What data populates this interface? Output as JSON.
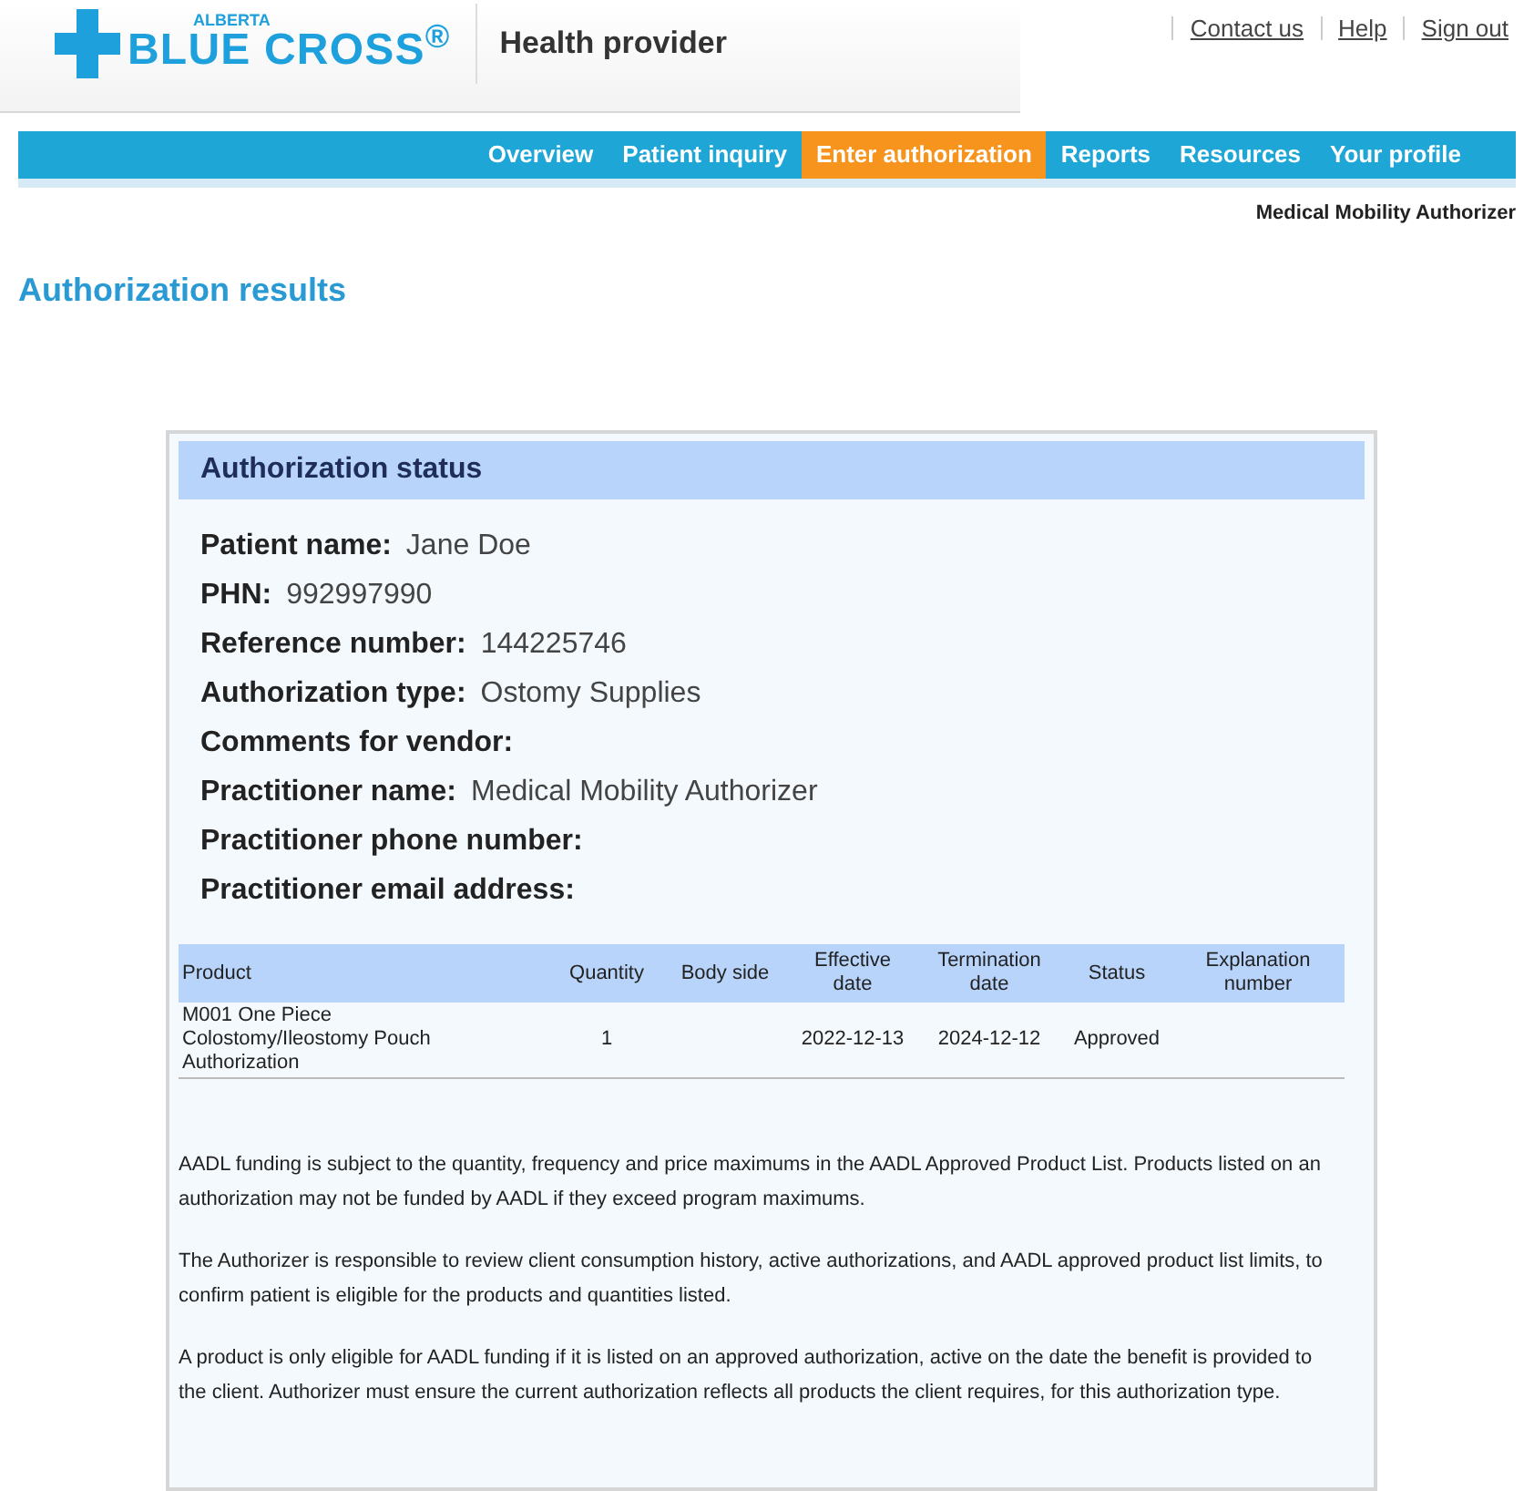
{
  "header": {
    "logo_top": "ALBERTA",
    "logo_main": "BLUE CROSS$^{®}$",
    "portal": "Health provider",
    "links": [
      "Contact us",
      "Help",
      "Sign out"
    ]
  },
  "nav": [
    {
      "label": "Overview",
      "selected": false
    },
    {
      "label": "Patient inquiry",
      "selected": false
    },
    {
      "label": "Enter authorization",
      "selected": true
    },
    {
      "label": "Reports",
      "selected": false
    },
    {
      "label": "Resources",
      "selected": false
    },
    {
      "label": "Your profile",
      "selected": false
    }
  ],
  "user": "Medical Mobility Authorizer",
  "page_title": "Authorization results",
  "card": {
    "title": "Authorization status",
    "fields": [
      {
        "label": "Patient name:",
        "value": "Jane Doe"
      },
      {
        "label": "PHN:",
        "value": "992997990"
      },
      {
        "label": "Reference number:",
        "value": "144225746"
      },
      {
        "label": "Authorization type:",
        "value": "Ostomy Supplies"
      },
      {
        "label": "Comments for vendor:"
      },
      {
        "label": "Practitioner name:",
        "value": "Medical Mobility Authorizer"
      },
      {
        "label": "Practitioner phone number:"
      },
      {
        "label": "Practitioner email address:"
      }
    ],
    "table": {
      "columns": [
        "Product",
        "Quantity",
        "Body side",
        "Effective date",
        "Termination date",
        "Status",
        "Explanation number"
      ],
      "rows": [
        [
          "M001 One Piece Colostomy/Ileostomy Pouch Authorization",
          "1",
          "",
          "2022-12-13",
          "2024-12-12",
          "Approved",
          ""
        ]
      ]
    },
    "notes": [
      "AADL funding is subject to the quantity, frequency and price maximums in the AADL Approved Product List. Products listed on an authorization may not be funded by AADL if they exceed program maximums.",
      "The Authorizer is responsible to review client consumption history, active authorizations, and AADL approved product list limits, to confirm patient is eligible for the products and quantities listed.",
      "A product is only eligible for AADL funding if it is listed on an approved authorization, active on the date the benefit is provided to the client. Authorizer must ensure the current authorization reflects all products the client requires, for this authorization type."
    ]
  }
}
